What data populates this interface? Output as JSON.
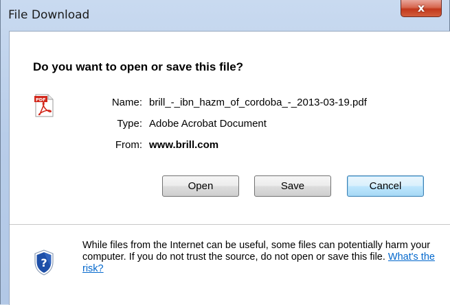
{
  "window": {
    "title": "File Download",
    "close_label": "x"
  },
  "dialog": {
    "question": "Do you want to open or save this file?",
    "file_icon": "pdf-file-icon",
    "name_label": "Name:",
    "name_value": "brill_-_ibn_hazm_of_cordoba_-_2013-03-19.pdf",
    "type_label": "Type:",
    "type_value": "Adobe Acrobat Document",
    "from_label": "From:",
    "from_value": "www.brill.com",
    "buttons": {
      "open": "Open",
      "save": "Save",
      "cancel": "Cancel"
    }
  },
  "footer": {
    "icon": "shield-help-icon",
    "warning_text": "While files from the Internet can be useful, some files can potentially harm your computer. If you do not trust the source, do not open or save this file.",
    "risk_link": "What's the risk?"
  },
  "colors": {
    "accent": "#0066cc",
    "pdf_red": "#d2261a",
    "shield_blue": "#1e4fa8"
  }
}
